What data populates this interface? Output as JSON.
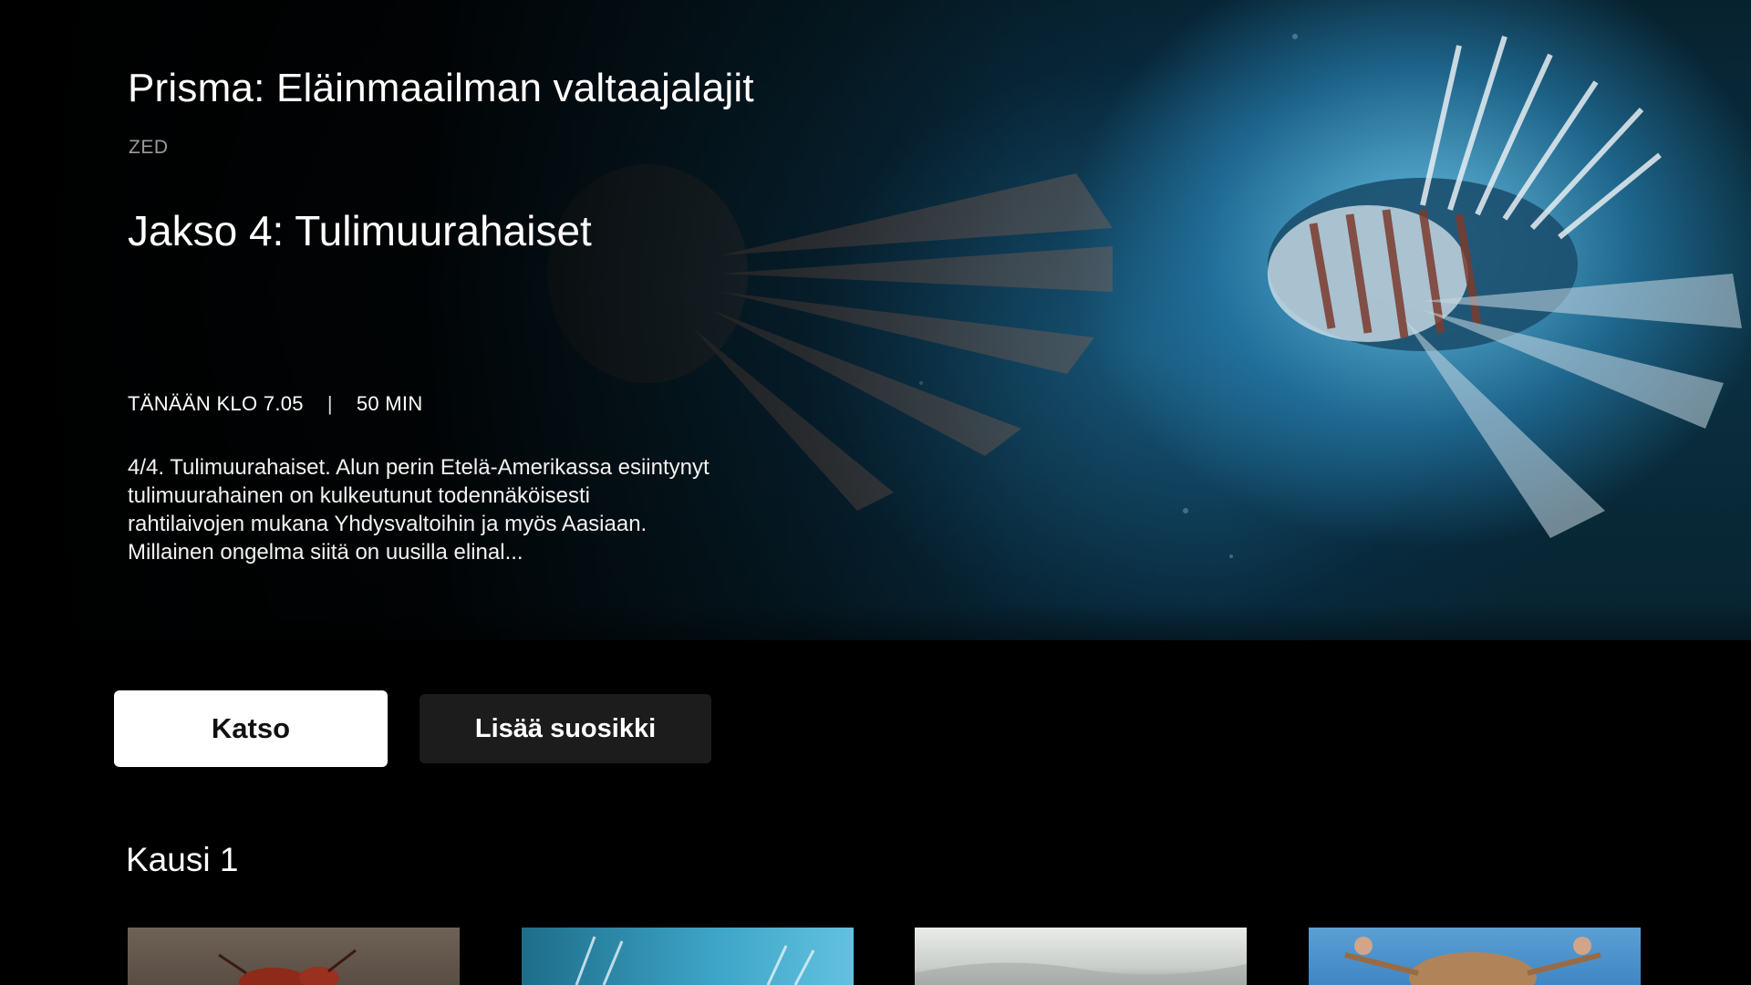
{
  "show": {
    "title": "Prisma: Eläinmaailman valtaajalajit",
    "channel": "ZED",
    "episode_title": "Jakso 4: Tulimuurahaiset",
    "air_time": "TÄNÄÄN KLO 7.05",
    "separator": "|",
    "duration": "50 MIN",
    "description": "4/4. Tulimuurahaiset. Alun perin Etelä-Amerikassa esiintynyt tulimuurahainen on kulkeutunut todennäköisesti rahtilaivojen mukana Yhdysvaltoihin ja myös Aasiaan. Millainen ongelma siitä on uusilla elinal..."
  },
  "actions": {
    "watch_label": "Katso",
    "favorite_label": "Lisää suosikki"
  },
  "season": {
    "label": "Kausi 1",
    "episodes": [
      {
        "thumb": "fire-ant-thumbnail"
      },
      {
        "thumb": "lionfish-thumbnail"
      },
      {
        "thumb": "foggy-forest-thumbnail"
      },
      {
        "thumb": "crab-thumbnail"
      }
    ]
  },
  "colors": {
    "background": "#000000",
    "primary_button": "#ffffff",
    "secondary_button": "#1c1c1c",
    "channel_text": "#9a9a9a"
  }
}
